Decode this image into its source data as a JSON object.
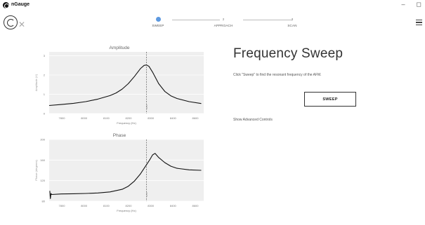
{
  "window": {
    "title": "nGauge",
    "minimize": "–",
    "maximize": "◻"
  },
  "stepper": {
    "steps": [
      {
        "number": "",
        "label": "SWEEP",
        "active": true
      },
      {
        "number": "2",
        "label": "APPROACH",
        "active": false
      },
      {
        "number": "3",
        "label": "SCAN",
        "active": false
      }
    ]
  },
  "main": {
    "headline": "Frequency Sweep",
    "instructions": "Click \"Sweep\" to find the resonant frequency of the AFM.",
    "sweep_button": "SWEEP",
    "advanced_link": "Show Advanced Controls"
  },
  "chart_data": [
    {
      "type": "line",
      "title": "Amplitude",
      "xlabel": "Frequency (Hz)",
      "ylabel": "Amplitude (V)",
      "xlim": [
        7450,
        8720
      ],
      "ylim": [
        0,
        3.2
      ],
      "xticks": [
        "7800",
        "8000",
        "8100",
        "8200",
        "8300",
        "8400",
        "8600"
      ],
      "yticks": [
        "0",
        "1",
        "2",
        "3"
      ],
      "marker_x": 8250,
      "marker_label": "8250",
      "grid": true,
      "series": [
        {
          "x": [
            7450,
            7550,
            7650,
            7750,
            7850,
            7950,
            8000,
            8050,
            8100,
            8150,
            8200,
            8230,
            8250,
            8270,
            8300,
            8350,
            8400,
            8450,
            8500,
            8600,
            8700
          ],
          "values": [
            0.42,
            0.47,
            0.53,
            0.62,
            0.75,
            0.93,
            1.07,
            1.27,
            1.55,
            1.92,
            2.33,
            2.5,
            2.52,
            2.45,
            2.15,
            1.55,
            1.15,
            0.92,
            0.78,
            0.62,
            0.52
          ]
        }
      ]
    },
    {
      "type": "line",
      "title": "Phase",
      "xlabel": "Frequency (Hz)",
      "ylabel": "Phase (degrees)",
      "xlim": [
        7450,
        8720
      ],
      "ylim": [
        80,
        200
      ],
      "xticks": [
        "7800",
        "8000",
        "8100",
        "8200",
        "8300",
        "8400",
        "8600"
      ],
      "yticks": [
        "80",
        "120",
        "160",
        "200"
      ],
      "marker_x": 8250,
      "marker_label": "8250",
      "grid": true,
      "series": [
        {
          "x": [
            7455,
            7460,
            7465,
            7470,
            7550,
            7650,
            7750,
            7850,
            7950,
            8050,
            8100,
            8150,
            8200,
            8250,
            8280,
            8300,
            8320,
            8350,
            8400,
            8450,
            8500,
            8600,
            8700
          ],
          "values": [
            100,
            85,
            95,
            93,
            94,
            94.5,
            95,
            96,
            98,
            103,
            109,
            119,
            133,
            151,
            162,
            170,
            173,
            165,
            155,
            148,
            144,
            141,
            140
          ]
        }
      ]
    }
  ]
}
